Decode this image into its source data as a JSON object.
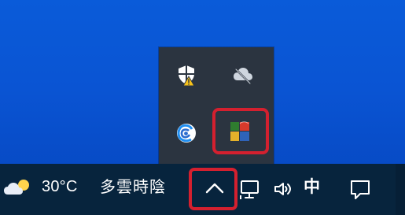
{
  "taskbar": {
    "weather": {
      "temperature": "30°C",
      "condition": "多雲時陰",
      "icon": "partly-cloudy-icon"
    },
    "system_tray": {
      "show_hidden_icons_icon": "chevron-up-icon",
      "network_icon": "network-icon",
      "volume_icon": "volume-icon",
      "ime_indicator": "中",
      "notifications_icon": "notification-icon"
    }
  },
  "tray_overflow": {
    "icons": [
      "security-shield-warning-icon",
      "cloud-sync-icon",
      "spiral-app-icon",
      "colorful-app-icon"
    ]
  },
  "colors": {
    "desktop": "#0a52d6",
    "taskbar": "#07243d",
    "tray_overflow": "#2b3440",
    "highlight": "#d4202f"
  }
}
